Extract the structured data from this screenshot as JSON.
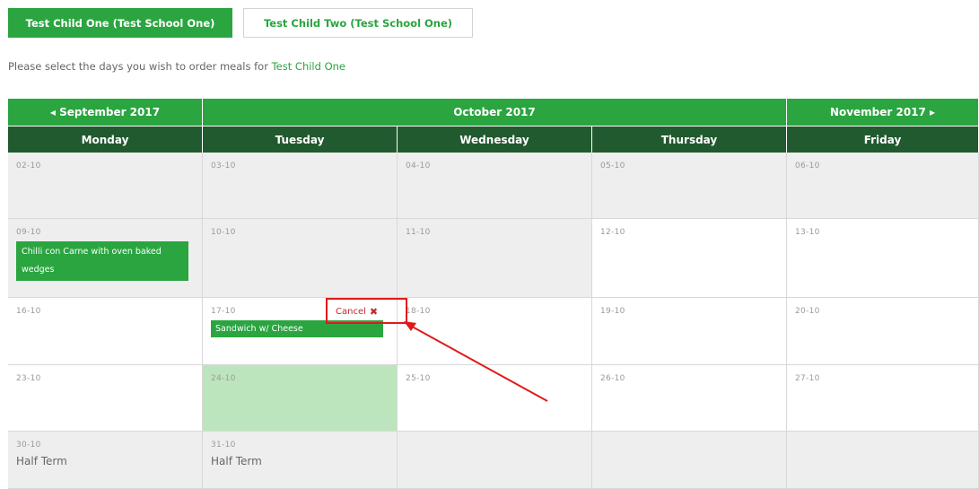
{
  "tabs": [
    {
      "label": "Test Child One (Test School One)",
      "active": true
    },
    {
      "label": "Test Child Two (Test School One)",
      "active": false
    }
  ],
  "intro": {
    "text": "Please select the days you wish to order meals for ",
    "child": "Test Child One"
  },
  "calendar": {
    "prev_month": "◂ September 2017",
    "current_month": "October 2017",
    "next_month": "November 2017 ▸",
    "days": [
      "Monday",
      "Tuesday",
      "Wednesday",
      "Thursday",
      "Friday"
    ],
    "weeks": [
      [
        "02-10",
        "03-10",
        "04-10",
        "05-10",
        "06-10"
      ],
      [
        "09-10",
        "10-10",
        "11-10",
        "12-10",
        "13-10"
      ],
      [
        "16-10",
        "17-10",
        "18-10",
        "19-10",
        "20-10"
      ],
      [
        "23-10",
        "24-10",
        "25-10",
        "26-10",
        "27-10"
      ],
      [
        "30-10",
        "31-10",
        "",
        "",
        ""
      ]
    ],
    "meals": {
      "w2_mon": "Chilli con Carne with oven baked wedges",
      "w3_tue": "Sandwich w/ Cheese"
    },
    "cancel_label": "Cancel",
    "half_term": "Half Term"
  },
  "colors": {
    "accent": "#2aa540",
    "header_dark": "#215a2e",
    "annotation": "#e01a1a"
  }
}
